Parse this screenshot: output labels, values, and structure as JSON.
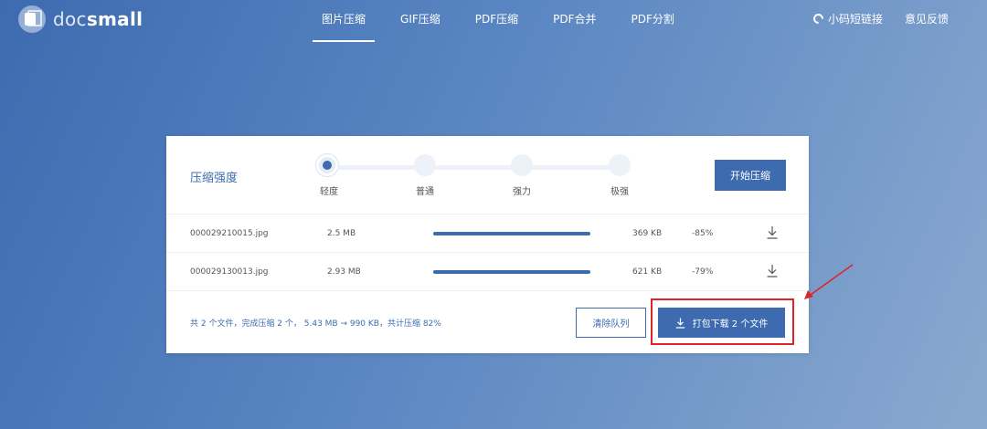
{
  "brand": {
    "doc": "doc",
    "small": "small"
  },
  "nav": {
    "items": [
      "图片压缩",
      "GIF压缩",
      "PDF压缩",
      "PDF合并",
      "PDF分割"
    ],
    "right": {
      "shortlink": "小码短链接",
      "feedback": "意见反馈"
    }
  },
  "card": {
    "strength_label": "压缩强度",
    "levels": [
      "轻度",
      "普通",
      "强力",
      "极强"
    ],
    "selected_level": "轻度",
    "start_button": "开始压缩",
    "files": [
      {
        "name": "000029210015.jpg",
        "size": "2.5 MB",
        "progress_percent": 100,
        "new_size": "369 KB",
        "reduction": "-85%"
      },
      {
        "name": "000029130013.jpg",
        "size": "2.93 MB",
        "progress_percent": 100,
        "new_size": "621 KB",
        "reduction": "-79%"
      }
    ],
    "summary": "共 2 个文件，完成压缩 2 个， 5.43 MB → 990 KB，共计压缩 82%",
    "clear_button": "清除队列",
    "download_all_button": "打包下载 2 个文件"
  },
  "colors": {
    "primary": "#3e6bb0",
    "annotation": "#e02424"
  }
}
